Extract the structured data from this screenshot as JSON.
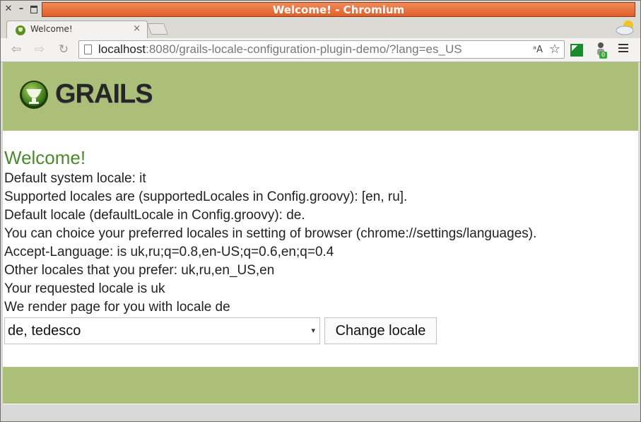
{
  "window": {
    "title": "Welcome! - Chromium"
  },
  "tabs": [
    {
      "title": "Welcome!",
      "close_label": "×"
    }
  ],
  "toolbar": {
    "back_icon": "back-arrow-icon",
    "forward_icon": "forward-arrow-icon",
    "reload_icon": "reload-icon",
    "url_host": "localhost",
    "url_rest": ":8080/grails-locale-configuration-plugin-demo/?lang=es_US",
    "translate_glyph": "ᵃA",
    "star_glyph": "☆"
  },
  "extensions": {
    "badge_count": "0"
  },
  "brand": {
    "logo_text": "GRAILS",
    "accent_color": "#abbf78",
    "heading_color": "#4a8a2c"
  },
  "content": {
    "heading": "Welcome!",
    "lines": [
      "Default system locale: it",
      "Supported locales are (supportedLocales in Config.groovy): [en, ru].",
      "Default locale (defaultLocale in Config.groovy): de.",
      "You can choice your preferred locales in setting of browser (chrome://settings/languages).",
      "Accept-Language: is uk,ru;q=0.8,en-US;q=0.6,en;q=0.4",
      "Other locales that you prefer: uk,ru,en_US,en",
      "Your requested locale is uk",
      "We render page for you with locale de"
    ],
    "locale_select": {
      "selected": "de, tedesco",
      "arrow": "▾"
    },
    "change_button": "Change locale"
  }
}
